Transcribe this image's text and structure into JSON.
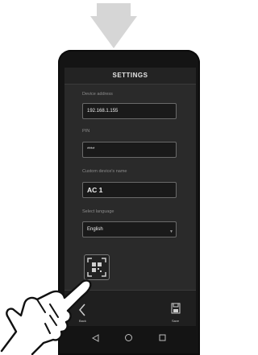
{
  "screen": {
    "title": "SETTINGS",
    "device_address": {
      "label": "Device address",
      "value": "192.168.1.155"
    },
    "pin": {
      "label": "PIN",
      "value": "****"
    },
    "custom_name": {
      "label": "Custom device's name",
      "value": "AC 1"
    },
    "language": {
      "label": "Select language",
      "value": "English"
    },
    "qr_button": {
      "icon": "qr-code-icon"
    }
  },
  "bottom_bar": {
    "back_label": "Back",
    "save_label": "Save"
  },
  "colors": {
    "screen_bg": "#2a2a2a",
    "arrow": "#d4d4d4"
  }
}
